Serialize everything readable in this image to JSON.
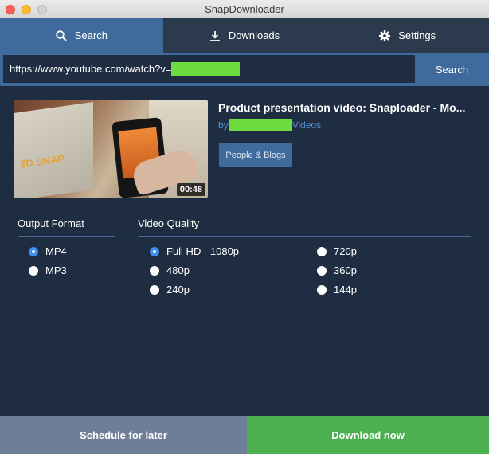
{
  "window": {
    "title": "SnapDownloader"
  },
  "tabs": [
    {
      "label": "Search",
      "icon": "search-icon",
      "active": true
    },
    {
      "label": "Downloads",
      "icon": "download-icon",
      "active": false
    },
    {
      "label": "Settings",
      "icon": "gear-icon",
      "active": false
    }
  ],
  "urlbar": {
    "value": "https://www.youtube.com/watch?v=",
    "search_label": "Search"
  },
  "video": {
    "title": "Product presentation video: Snaploader - Mo...",
    "by_prefix": "by",
    "by_suffix": "Videos",
    "category": "People & Blogs",
    "duration": "00:48",
    "thumb_brand": "3D SNAP"
  },
  "output_format": {
    "label": "Output Format",
    "options": [
      {
        "label": "MP4",
        "selected": true
      },
      {
        "label": "MP3",
        "selected": false
      }
    ]
  },
  "video_quality": {
    "label": "Video Quality",
    "options": [
      {
        "label": "Full HD - 1080p",
        "selected": true
      },
      {
        "label": "480p",
        "selected": false
      },
      {
        "label": "240p",
        "selected": false
      },
      {
        "label": "720p",
        "selected": false
      },
      {
        "label": "360p",
        "selected": false
      },
      {
        "label": "144p",
        "selected": false
      }
    ]
  },
  "actions": {
    "schedule_label": "Schedule for later",
    "download_label": "Download now"
  },
  "colors": {
    "background": "#1f2d42",
    "accent": "#3e6a9c",
    "download": "#4caf50",
    "schedule": "#6d7e96",
    "radio_selected": "#3d8ef0",
    "redaction": "#6ddc3f"
  }
}
